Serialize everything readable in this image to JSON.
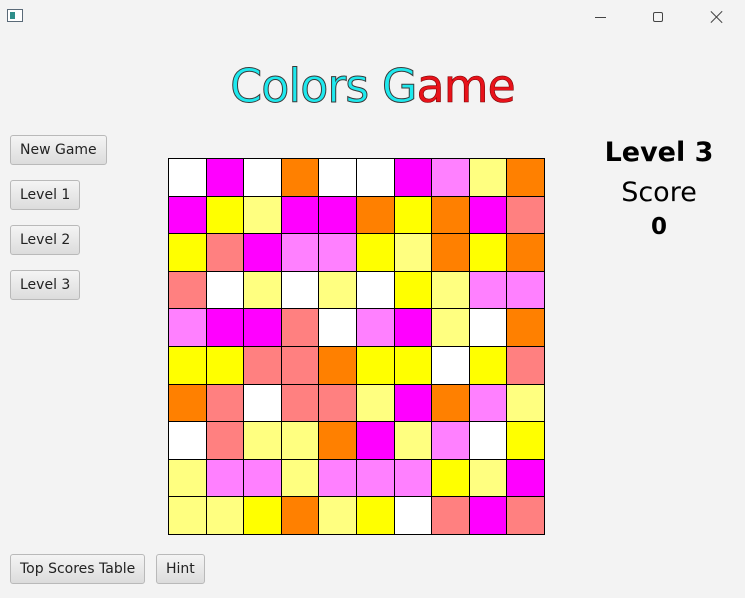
{
  "window": {
    "title": ""
  },
  "title": {
    "part_cyan": "Colors G",
    "part_red": "ame",
    "text": "Colors Game"
  },
  "buttons": {
    "new_game": "New Game",
    "level1": "Level 1",
    "level2": "Level 2",
    "level3": "Level 3",
    "top_scores": "Top Scores Table",
    "hint": "Hint"
  },
  "status": {
    "level": "Level 3",
    "score_label": "Score",
    "score_value": "0"
  },
  "colors": {
    "W": "#ffffff",
    "M": "#ff00ff",
    "O": "#ff8000",
    "P": "#ff80ff",
    "Y": "#ffff00",
    "L": "#ffff80",
    "S": "#ff8080"
  },
  "board": [
    [
      "W",
      "M",
      "W",
      "O",
      "W",
      "W",
      "M",
      "P",
      "L",
      "O"
    ],
    [
      "M",
      "Y",
      "L",
      "M",
      "M",
      "O",
      "Y",
      "O",
      "M",
      "S"
    ],
    [
      "Y",
      "S",
      "M",
      "P",
      "P",
      "Y",
      "L",
      "O",
      "Y",
      "O"
    ],
    [
      "S",
      "W",
      "L",
      "W",
      "L",
      "W",
      "Y",
      "L",
      "P",
      "P"
    ],
    [
      "P",
      "M",
      "M",
      "S",
      "W",
      "P",
      "M",
      "L",
      "W",
      "O"
    ],
    [
      "Y",
      "Y",
      "S",
      "S",
      "O",
      "Y",
      "Y",
      "W",
      "Y",
      "S"
    ],
    [
      "O",
      "S",
      "W",
      "S",
      "S",
      "L",
      "M",
      "O",
      "P",
      "L"
    ],
    [
      "W",
      "S",
      "L",
      "L",
      "O",
      "M",
      "L",
      "P",
      "W",
      "Y"
    ],
    [
      "L",
      "P",
      "P",
      "L",
      "P",
      "P",
      "P",
      "Y",
      "L",
      "M"
    ],
    [
      "L",
      "L",
      "Y",
      "O",
      "L",
      "Y",
      "W",
      "S",
      "M",
      "S"
    ]
  ]
}
